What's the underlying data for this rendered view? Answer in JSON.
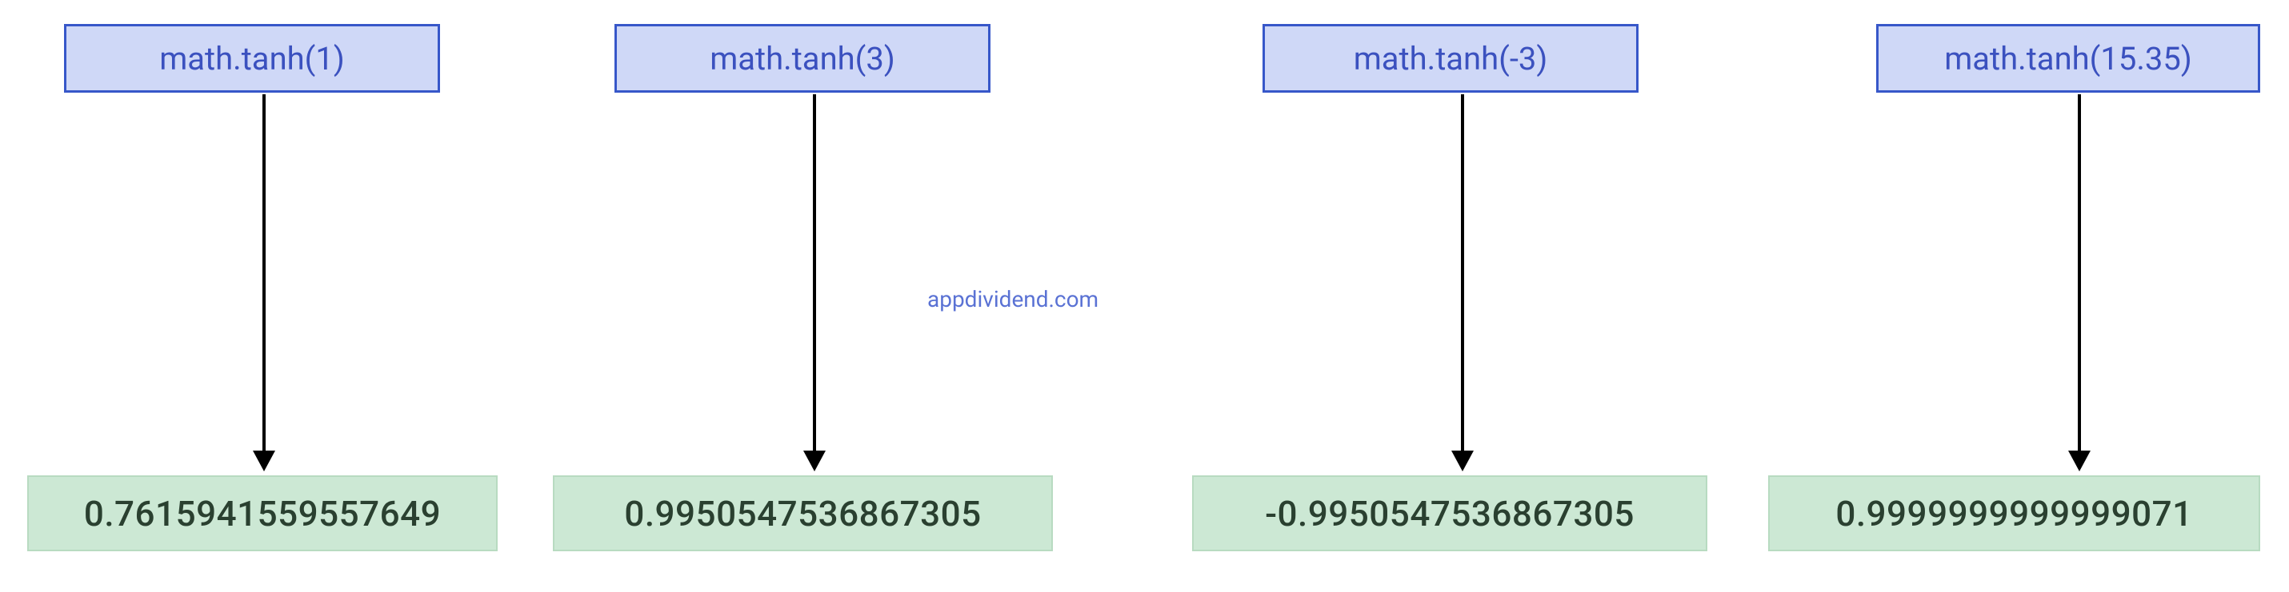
{
  "watermark": "appdividend.com",
  "items": [
    {
      "input": "math.tanh(1)",
      "output": "0.7615941559557649"
    },
    {
      "input": "math.tanh(3)",
      "output": "0.9950547536867305"
    },
    {
      "input": "math.tanh(-3)",
      "output": "-0.9950547536867305"
    },
    {
      "input": "math.tanh(15.35)",
      "output": "0.9999999999999071"
    }
  ]
}
